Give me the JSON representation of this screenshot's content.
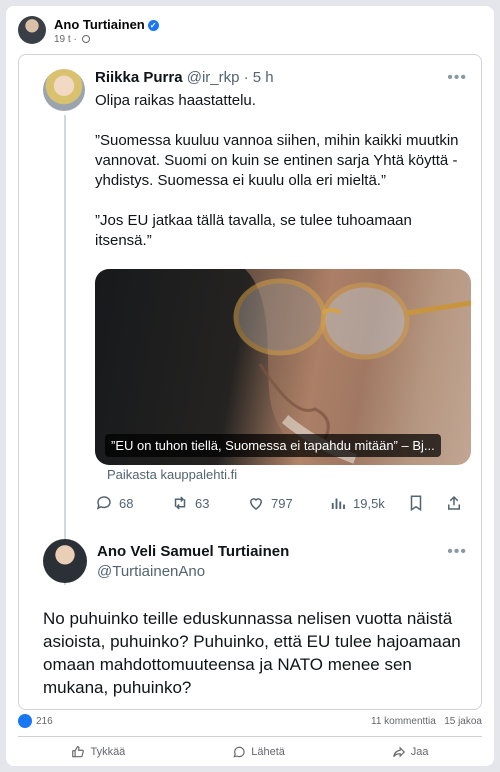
{
  "post": {
    "author": "Ano Turtiainen",
    "time": "19 t"
  },
  "embed": {
    "tweet": {
      "name": "Riikka Purra",
      "handle": "@ir_rkp",
      "time": "5 h",
      "paragraphs": [
        "Olipa raikas haastattelu.",
        "”Suomessa kuuluu vannoa siihen, mihin kaikki muutkin vannovat. Suomi on kuin se entinen sarja Yhtä köyttä -yhdistys. Suomessa ei kuulu olla eri mieltä.”",
        "”Jos EU jatkaa tällä tavalla, se tulee tuhoamaan itsensä.”"
      ],
      "link_caption": "”EU on tuhon tiellä, Suomessa ei tapahdu mitään” – Bj...",
      "source": "Paikasta kauppalehti.fi",
      "replies": "68",
      "retweets": "63",
      "likes": "797",
      "views": "19,5k"
    },
    "reply": {
      "name": "Ano Veli Samuel Turtiainen",
      "handle": "@TurtiainenAno",
      "text": "No puhuinko teille eduskunnassa nelisen vuotta näistä asioista, puhuinko? Puhuinko, että EU tulee hajoamaan omaan mahdottomuuteensa ja NATO menee sen mukana, puhuinko?"
    }
  },
  "stats": {
    "reactions": "216",
    "comments": "11 kommenttia",
    "shares": "15 jakoa"
  },
  "actions": {
    "like": "Tykkää",
    "send": "Lähetä",
    "share": "Jaa"
  },
  "colors": {
    "fb_blue": "#1877f2",
    "twitter_text": "#0f1419",
    "twitter_secondary": "#536471"
  }
}
